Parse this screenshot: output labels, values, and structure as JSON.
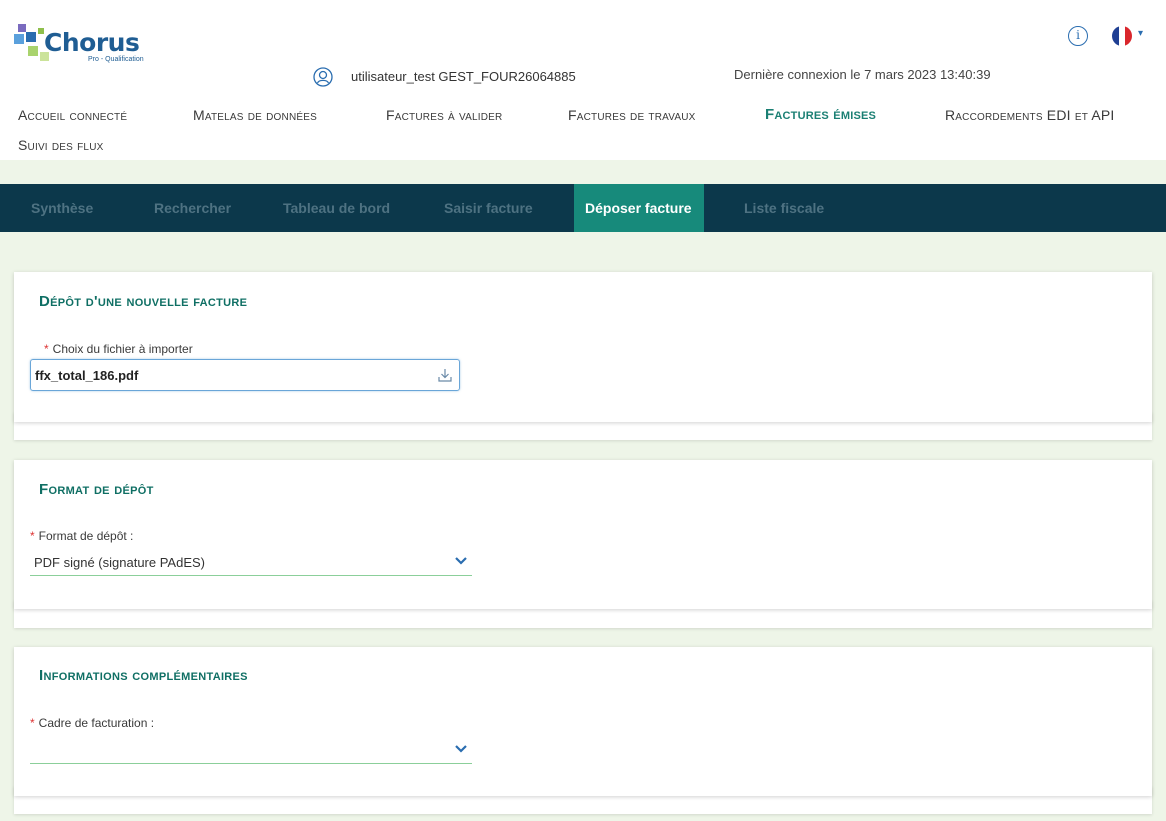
{
  "header": {
    "logo": {
      "name": "Chorus",
      "sub": "Pro - Qualification"
    },
    "user_name": "utilisateur_test GEST_FOUR26064885",
    "last_login": "Dernière connexion le 7 mars 2023 13:40:39",
    "info_label": "i"
  },
  "main_nav": {
    "items": [
      {
        "label": "Accueil connecté"
      },
      {
        "label": "Matelas de données"
      },
      {
        "label": "Factures à valider"
      },
      {
        "label": "Factures de travaux"
      },
      {
        "label": "Factures émises"
      },
      {
        "label": "Raccordements EDI et API"
      },
      {
        "label": "Suivi des flux"
      }
    ],
    "active_index": 4
  },
  "sub_nav": {
    "tabs": [
      {
        "label": "Synthèse"
      },
      {
        "label": "Rechercher"
      },
      {
        "label": "Tableau de bord"
      },
      {
        "label": "Saisir facture"
      },
      {
        "label": "Déposer facture"
      },
      {
        "label": "Liste fiscale"
      }
    ],
    "active_index": 4
  },
  "depot": {
    "title": "Dépôt d'une nouvelle facture",
    "file_label": "Choix du fichier à importer",
    "file_value": "ffx_total_186.pdf",
    "required_marker": "*"
  },
  "format": {
    "title": "Format de dépôt",
    "label": "Format de dépôt :",
    "value": "PDF signé (signature PAdES)"
  },
  "infos": {
    "title": "Informations complémentaires",
    "label": "Cadre de facturation :",
    "value": ""
  },
  "colors": {
    "accent": "#178a7b",
    "subnav_bg": "#0c384b",
    "page_bg": "#eef5e8",
    "title_green": "#0f6f64",
    "required": "#dd3333"
  }
}
